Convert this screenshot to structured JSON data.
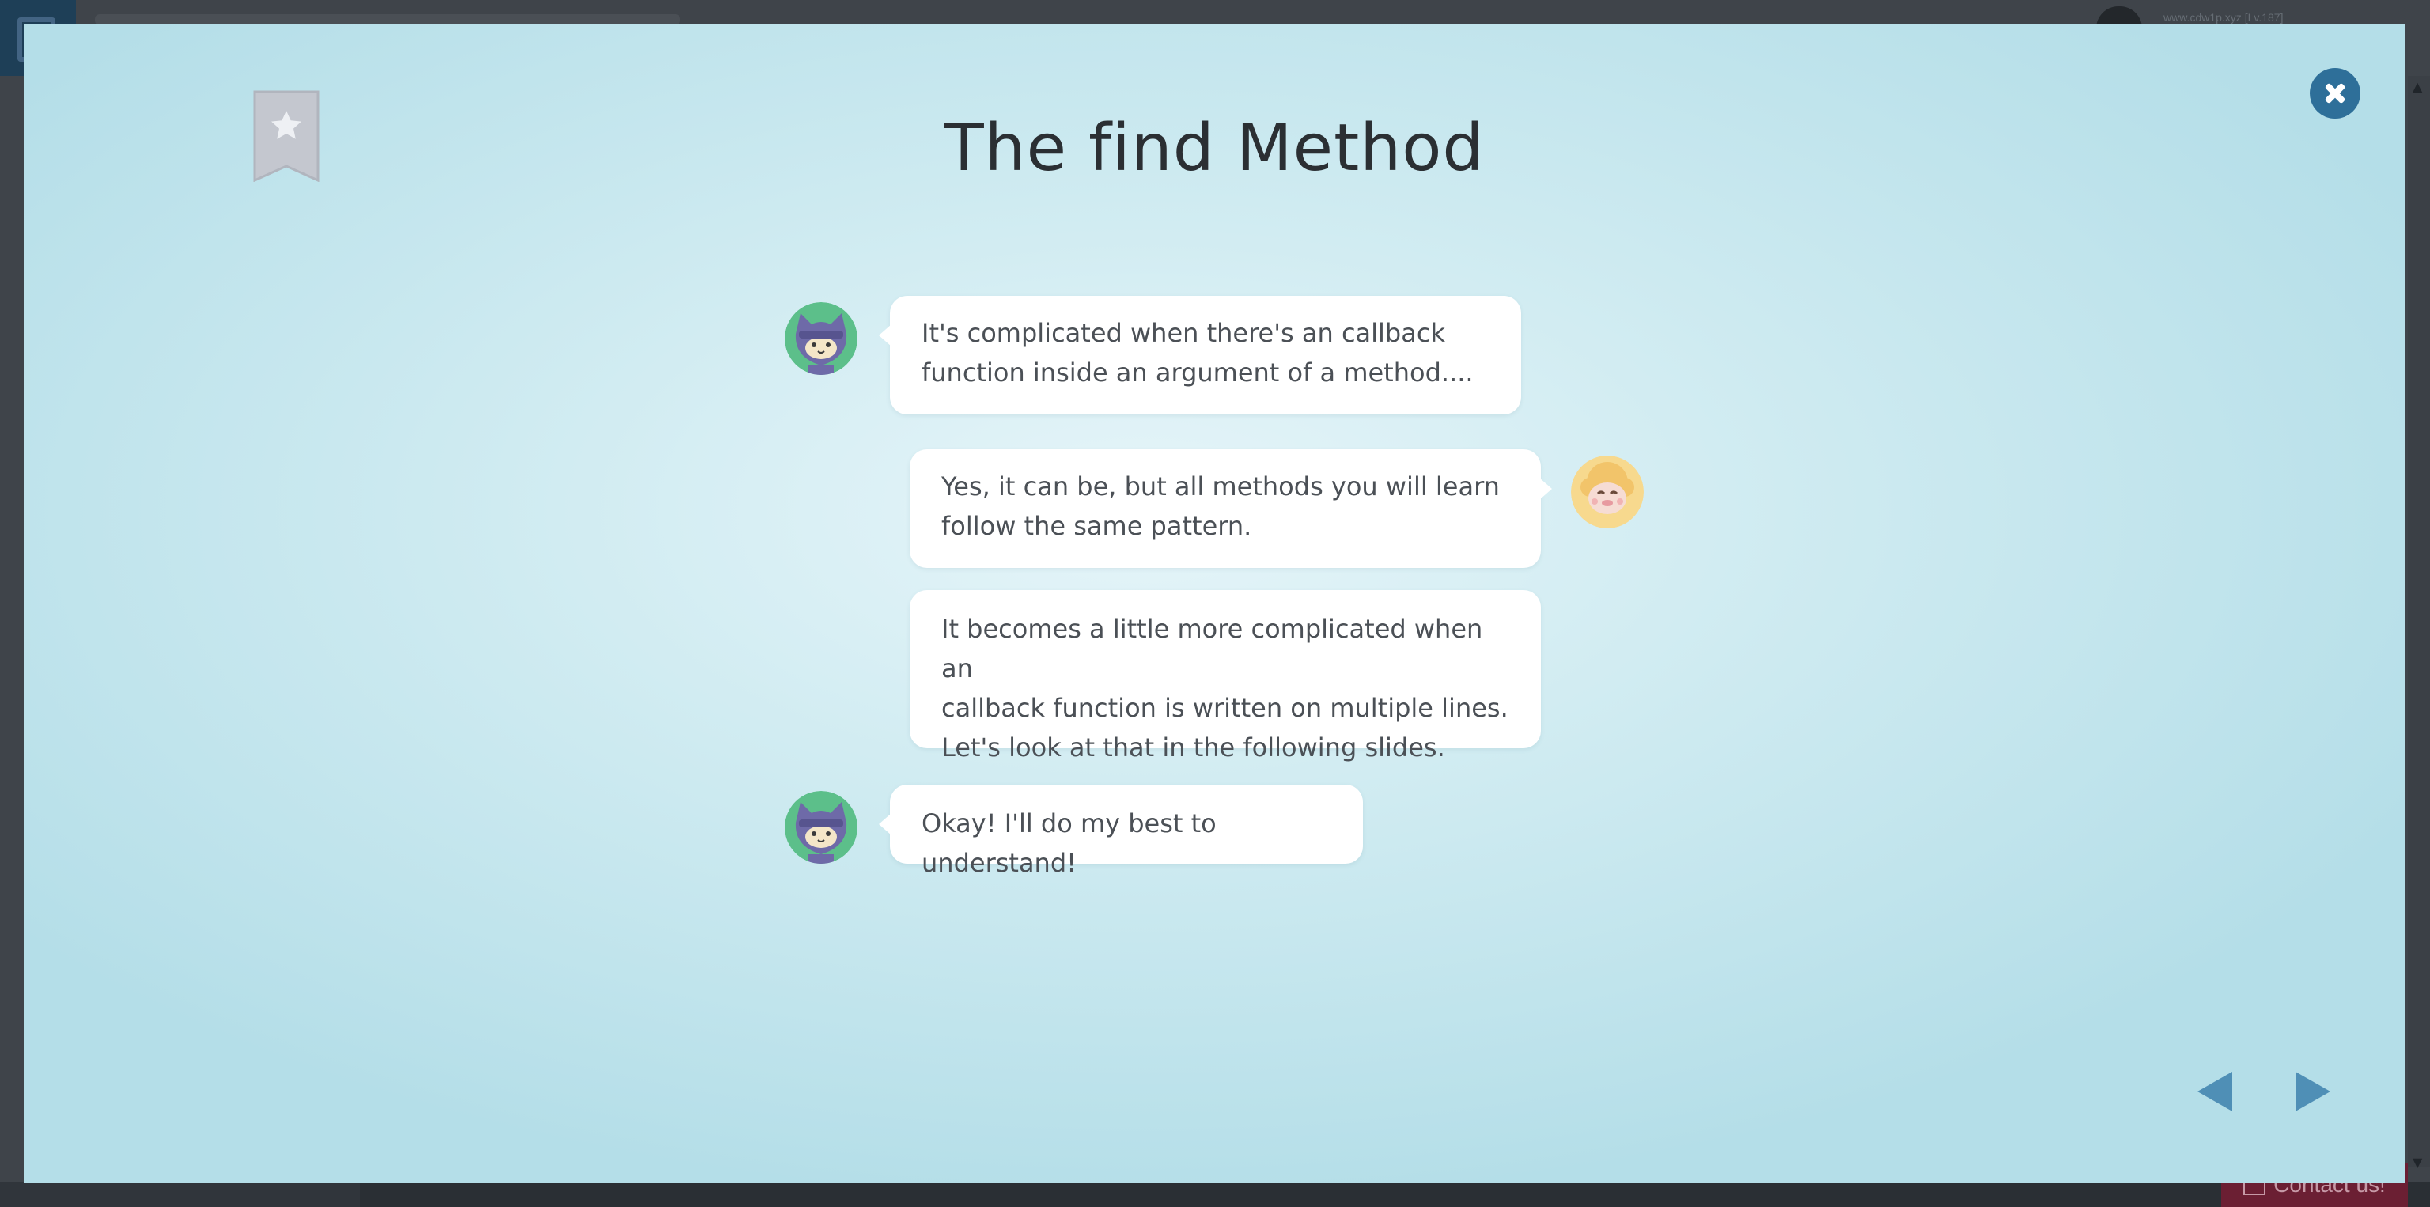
{
  "background": {
    "user_text": "www.cdw1p.xyz [Lv.187]",
    "contact_label": "Contact us!"
  },
  "lesson": {
    "title": "The find Method",
    "icons": {
      "bookmark": "bookmark-star-icon",
      "close": "close-icon",
      "prev": "prev-arrow-icon",
      "next": "next-arrow-icon"
    },
    "colors": {
      "bookmark": "#c4c7cf",
      "close": "#2e6f99",
      "nav": "#4f8fb6",
      "text": "#4b5056",
      "title": "#2b2f33"
    },
    "messages": [
      {
        "speaker": "ninja-cat",
        "side": "left",
        "text": "It's complicated when there's an callback\nfunction inside an argument of a method...."
      },
      {
        "speaker": "sheep",
        "side": "right",
        "text": "Yes, it can be, but all methods you will learn\nfollow the same pattern."
      },
      {
        "speaker": "sheep",
        "side": "right",
        "text": "It becomes a little more complicated when an\ncallback function is written on multiple lines.\nLet's look at that in the following slides."
      },
      {
        "speaker": "ninja-cat",
        "side": "left",
        "text": "Okay! I'll do my best to understand!"
      }
    ]
  }
}
